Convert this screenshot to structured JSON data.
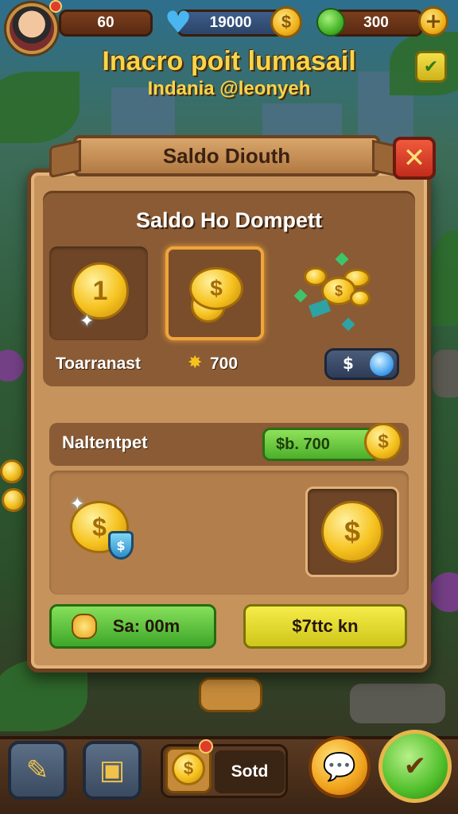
{
  "hud": {
    "lives_value": "60",
    "gold_value": "19000",
    "gem_value": "300",
    "plus_label": "+"
  },
  "title": {
    "main": "Inacro poit lumasail",
    "subtitle": "Indania @leonyeh"
  },
  "dialog": {
    "header": "Saldo Diouth",
    "close_label": "✕",
    "panel_title": "Saldo Ho Dompett",
    "row1_label": "Toarranast",
    "row1_value": "700",
    "toggle_label": "$",
    "row2_label": "Naltentpet",
    "row2_value": "$b. 700",
    "btn_left_label": "Sa: 00m",
    "btn_right_label": "$7ttc kn"
  },
  "bottom": {
    "shop_label": "Sotd"
  },
  "icons": {
    "coin_symbol": "$",
    "coin_one": "1",
    "star": "✸",
    "heart": "♥",
    "sparkle": "✦",
    "tool_a": "✎",
    "tool_b": "▣",
    "chat": "💬",
    "confirm": "✔"
  },
  "colors": {
    "accent_gold": "#f6c21f",
    "dialog_wood": "#c6935c",
    "close_red": "#c22c1c",
    "green_button": "#4caf2a",
    "yellow_button": "#f6ec4a"
  }
}
